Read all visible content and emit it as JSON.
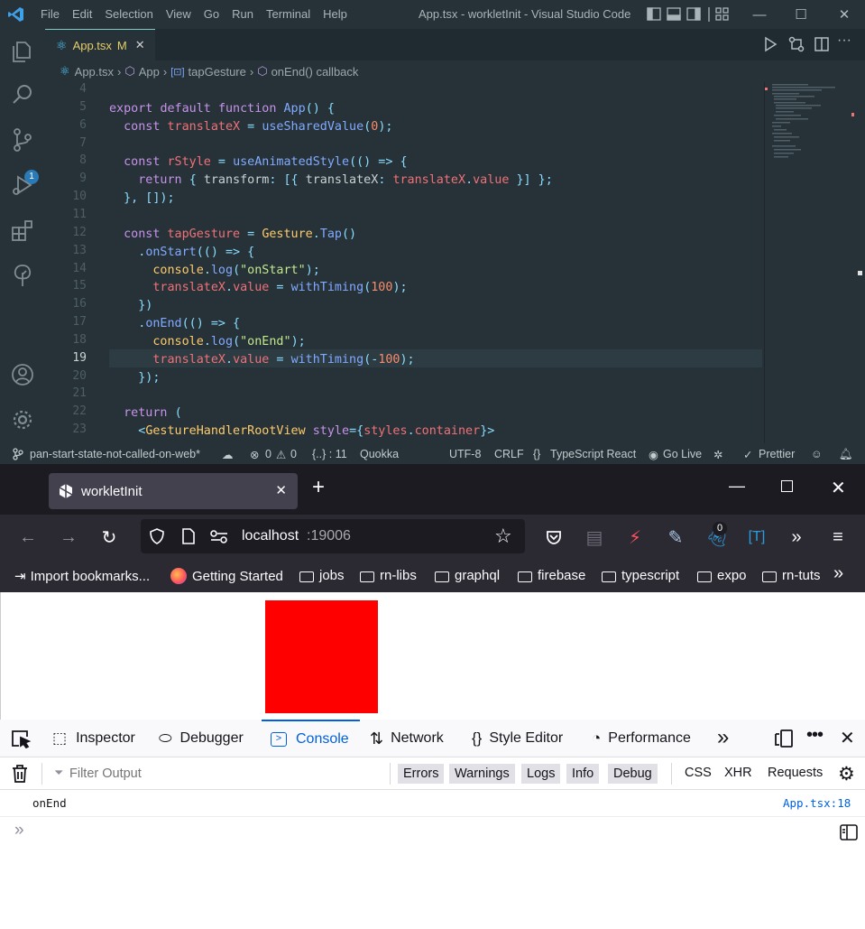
{
  "vscode": {
    "menu": [
      "File",
      "Edit",
      "Selection",
      "View",
      "Go",
      "Run",
      "Terminal",
      "Help"
    ],
    "window_title": "App.tsx - workletInit - Visual Studio Code",
    "tab": {
      "name": "App.tsx",
      "status": "M"
    },
    "scm_badge": "1",
    "breadcrumb": [
      "App.tsx",
      "App",
      "tapGesture",
      "onEnd() callback"
    ],
    "line_numbers": [
      "4",
      "5",
      "6",
      "7",
      "8",
      "9",
      "10",
      "11",
      "12",
      "13",
      "14",
      "15",
      "16",
      "17",
      "18",
      "19",
      "20",
      "21",
      "22",
      "23"
    ],
    "current_line": "19",
    "status": {
      "branch": "pan-start-state-not-called-on-web*",
      "errors": "0",
      "warnings": "0",
      "position": "{..} : 11",
      "quokka": "Quokka",
      "encoding": "UTF-8",
      "eol": "CRLF",
      "language": "TypeScript React",
      "golive": "Go Live",
      "prettier": "Prettier"
    }
  },
  "code_lines": [
    [],
    [
      [
        "kw",
        "export "
      ],
      [
        "kw",
        "default "
      ],
      [
        "kw",
        "function "
      ],
      [
        "fn",
        "App"
      ],
      [
        "pn",
        "() {"
      ]
    ],
    [
      [
        "pl",
        "  "
      ],
      [
        "kw",
        "const "
      ],
      [
        "vr",
        "translateX"
      ],
      [
        "pn",
        " = "
      ],
      [
        "fn",
        "useSharedValue"
      ],
      [
        "pn",
        "("
      ],
      [
        "num",
        "0"
      ],
      [
        "pn",
        ");"
      ]
    ],
    [],
    [
      [
        "pl",
        "  "
      ],
      [
        "kw",
        "const "
      ],
      [
        "vr",
        "rStyle"
      ],
      [
        "pn",
        " = "
      ],
      [
        "fn",
        "useAnimatedStyle"
      ],
      [
        "pn",
        "(() => {"
      ]
    ],
    [
      [
        "pl",
        "    "
      ],
      [
        "kw",
        "return "
      ],
      [
        "pn",
        "{ "
      ],
      [
        "prop",
        "transform"
      ],
      [
        "pn",
        ": [{ "
      ],
      [
        "prop",
        "translateX"
      ],
      [
        "pn",
        ": "
      ],
      [
        "vr",
        "translateX"
      ],
      [
        "pn",
        "."
      ],
      [
        "vr",
        "value"
      ],
      [
        "pn",
        " }] };"
      ]
    ],
    [
      [
        "pl",
        "  "
      ],
      [
        "pn",
        "}, []);"
      ]
    ],
    [],
    [
      [
        "pl",
        "  "
      ],
      [
        "kw",
        "const "
      ],
      [
        "vr",
        "tapGesture"
      ],
      [
        "pn",
        " = "
      ],
      [
        "cls",
        "Gesture"
      ],
      [
        "pn",
        "."
      ],
      [
        "fn",
        "Tap"
      ],
      [
        "pn",
        "()"
      ]
    ],
    [
      [
        "pl",
        "    "
      ],
      [
        "pn",
        "."
      ],
      [
        "fn",
        "onStart"
      ],
      [
        "pn",
        "(() => {"
      ]
    ],
    [
      [
        "pl",
        "      "
      ],
      [
        "cls",
        "console"
      ],
      [
        "pn",
        "."
      ],
      [
        "fn",
        "log"
      ],
      [
        "pn",
        "("
      ],
      [
        "str",
        "\"onStart\""
      ],
      [
        "pn",
        ");"
      ]
    ],
    [
      [
        "pl",
        "      "
      ],
      [
        "vr",
        "translateX"
      ],
      [
        "pn",
        "."
      ],
      [
        "vr",
        "value"
      ],
      [
        "pn",
        " = "
      ],
      [
        "fn",
        "withTiming"
      ],
      [
        "pn",
        "("
      ],
      [
        "num",
        "100"
      ],
      [
        "pn",
        ");"
      ]
    ],
    [
      [
        "pl",
        "    "
      ],
      [
        "pn",
        "})"
      ]
    ],
    [
      [
        "pl",
        "    "
      ],
      [
        "pn",
        "."
      ],
      [
        "fn",
        "onEnd"
      ],
      [
        "pn",
        "(() => {"
      ]
    ],
    [
      [
        "pl",
        "      "
      ],
      [
        "cls",
        "console"
      ],
      [
        "pn",
        "."
      ],
      [
        "fn",
        "log"
      ],
      [
        "pn",
        "("
      ],
      [
        "str",
        "\"onEnd\""
      ],
      [
        "pn",
        ");"
      ]
    ],
    [
      [
        "pl",
        "      "
      ],
      [
        "vr",
        "translateX"
      ],
      [
        "pn",
        "."
      ],
      [
        "vr",
        "value"
      ],
      [
        "pn",
        " = "
      ],
      [
        "fn",
        "withTiming"
      ],
      [
        "pn",
        "("
      ],
      [
        "pn",
        "-"
      ],
      [
        "num",
        "100"
      ],
      [
        "pn",
        ");"
      ]
    ],
    [
      [
        "pl",
        "    "
      ],
      [
        "pn",
        "});"
      ]
    ],
    [],
    [
      [
        "pl",
        "  "
      ],
      [
        "kw",
        "return "
      ],
      [
        "pn",
        "("
      ]
    ],
    [
      [
        "pl",
        "    "
      ],
      [
        "pn",
        "<"
      ],
      [
        "cls",
        "GestureHandlerRootView "
      ],
      [
        "kw",
        "style"
      ],
      [
        "pn",
        "={"
      ],
      [
        "vr",
        "styles"
      ],
      [
        "pn",
        "."
      ],
      [
        "vr",
        "container"
      ],
      [
        "pn",
        "}>"
      ]
    ]
  ],
  "firefox": {
    "tab_title": "workletInit",
    "url_host": "localhost",
    "url_port": ":19006",
    "ext_badge": "0",
    "bookmarks": [
      "Import bookmarks...",
      "Getting Started",
      "jobs",
      "rn-libs",
      "graphql",
      "firebase",
      "typescript",
      "expo",
      "rn-tuts"
    ]
  },
  "devtools": {
    "tabs": [
      "Inspector",
      "Debugger",
      "Console",
      "Network",
      "Style Editor",
      "Performance"
    ],
    "active_tab": "Console",
    "filter_placeholder": "Filter Output",
    "levels": [
      "Errors",
      "Warnings",
      "Logs",
      "Info",
      "Debug"
    ],
    "types": [
      "CSS",
      "XHR",
      "Requests"
    ],
    "message": {
      "text": "onEnd",
      "source": "App.tsx:18"
    }
  },
  "colors": {
    "box": "#ff0000",
    "accent": "#0061e0"
  }
}
